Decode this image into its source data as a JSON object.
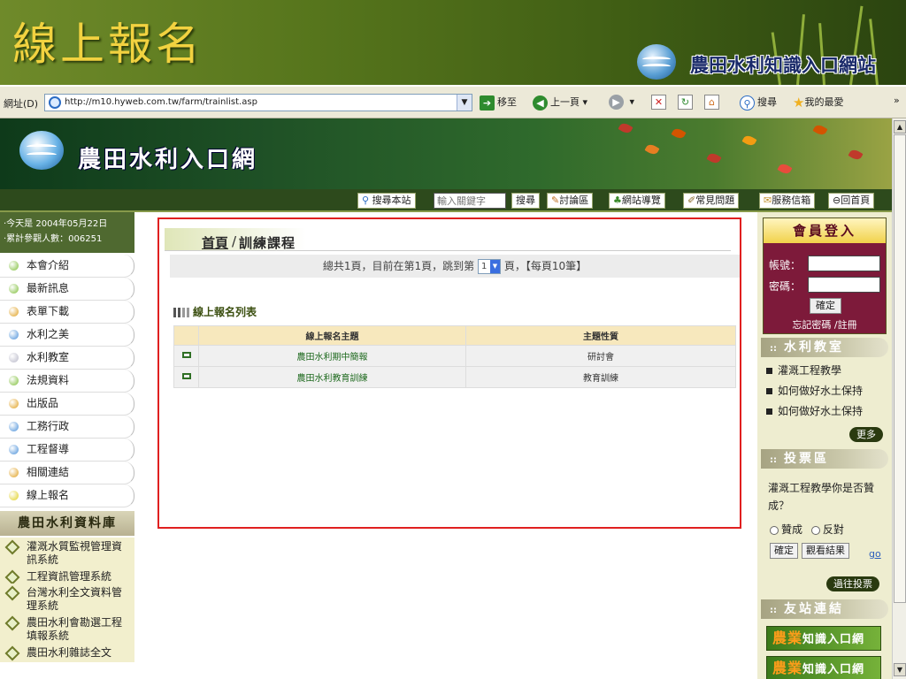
{
  "slide": {
    "title": "線上報名",
    "brand": "農田水利知識入口網站"
  },
  "browser": {
    "address_label": "網址(D)",
    "url": "http://m10.hyweb.com.tw/farm/trainlist.asp",
    "go_label": "移至",
    "back_label": "上一頁",
    "search_label": "搜尋",
    "favorites_label": "我的最愛",
    "overflow": "»"
  },
  "site": {
    "title": "農田水利入口網"
  },
  "nav": {
    "search_site": "搜尋本站",
    "keyword_placeholder": "輸入關鍵字",
    "search_button": "搜尋",
    "forum": "討論區",
    "sitemap": "網站導覽",
    "faq": "常見問題",
    "mailbox": "服務信箱",
    "home": "回首頁"
  },
  "sidebar": {
    "today": "‧今天是 2004年05月22日",
    "visits": "‧累計參觀人數：006251",
    "items": [
      {
        "label": "本會介紹",
        "color": "#7fbf3a"
      },
      {
        "label": "最新訊息",
        "color": "#7fbf3a"
      },
      {
        "label": "表單下載",
        "color": "#e0a020"
      },
      {
        "label": "水利之美",
        "color": "#4a90d9"
      },
      {
        "label": "水利教室",
        "color": "#b8b8c8"
      },
      {
        "label": "法規資料",
        "color": "#7fbf3a"
      },
      {
        "label": "出版品",
        "color": "#e0a020"
      },
      {
        "label": "工務行政",
        "color": "#4a90d9"
      },
      {
        "label": "工程督導",
        "color": "#4a90d9"
      },
      {
        "label": "相關連結",
        "color": "#e0a020"
      },
      {
        "label": "線上報名",
        "color": "#e0d020"
      }
    ],
    "db_title": "農田水利資料庫",
    "db_items": [
      "灌溉水質監視管理資訊系統",
      "工程資訊管理系統",
      "台灣水利全文資料管理系統",
      "農田水利會勘選工程填報系統",
      "農田水利雜誌全文"
    ]
  },
  "main": {
    "breadcrumb_home": "首頁",
    "breadcrumb_sep": "/",
    "breadcrumb_current": "訓練課程",
    "pager_before": "總共1頁，目前在第1頁，跳到第",
    "pager_page": "1",
    "pager_after": "頁，【每頁10筆】",
    "list_title": "線上報名列表",
    "columns": [
      "線上報名主題",
      "主題性質"
    ],
    "rows": [
      {
        "topic": "農田水利期中簡報",
        "type": "研討會"
      },
      {
        "topic": "農田水利教育訓練",
        "type": "教育訓練"
      }
    ]
  },
  "right": {
    "login_title": "會員登入",
    "account_label": "帳號：",
    "password_label": "密碼：",
    "submit": "確定",
    "forgot": "忘記密碼 /註冊",
    "classroom_title": "水利教室",
    "section_prefix": "::",
    "classroom_items": [
      "灌溉工程教學",
      "如何做好水土保持",
      "如何做好水土保持"
    ],
    "more": "更多",
    "poll_title": "投票區",
    "poll_question": "灌溉工程教學你是否贊成？",
    "poll_yes": "贊成",
    "poll_no": "反對",
    "poll_submit": "確定",
    "poll_results": "觀看結果",
    "poll_go": "go",
    "poll_past": "過往投票",
    "friends_title": "友站連結",
    "banner_big": "農業",
    "banner_rest": "知識入口網"
  }
}
